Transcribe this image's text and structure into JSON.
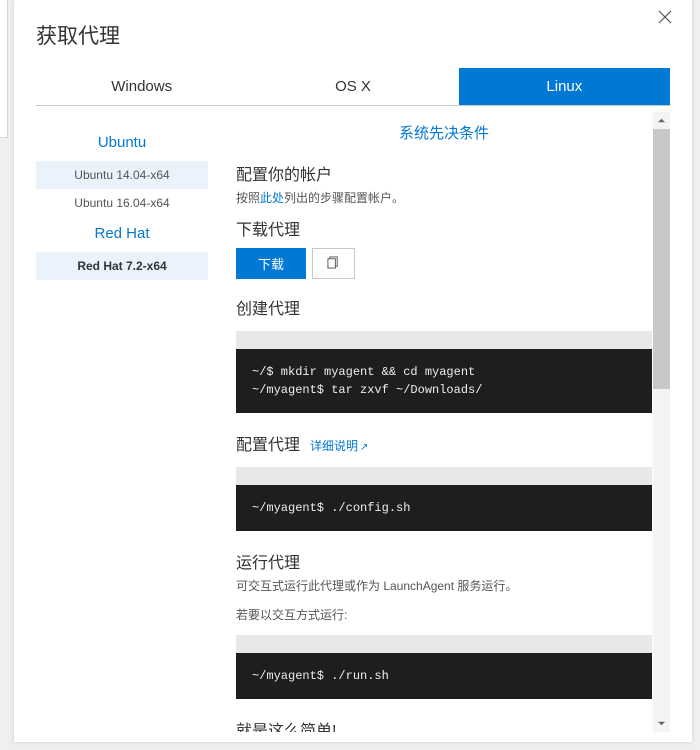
{
  "dialog": {
    "title": "获取代理"
  },
  "tabs": {
    "windows": "Windows",
    "osx": "OS X",
    "linux": "Linux"
  },
  "sidebar": {
    "group_ubuntu": "Ubuntu",
    "item_ubuntu14": "Ubuntu 14.04-x64",
    "item_ubuntu16": "Ubuntu 16.04-x64",
    "group_redhat": "Red Hat",
    "item_redhat72": "Red Hat 7.2-x64"
  },
  "content": {
    "prereq_link": "系统先决条件",
    "configure_account_heading": "配置你的帐户",
    "configure_account_sub_prefix": "按照",
    "configure_account_sub_link": "此处",
    "configure_account_sub_suffix": "列出的步骤配置帐户。",
    "download_heading": "下载代理",
    "download_button": "下载",
    "create_heading": "创建代理",
    "create_code": "~/$ mkdir myagent && cd myagent\n~/myagent$ tar zxvf ~/Downloads/",
    "config_heading": "配置代理",
    "config_detail_link": "详细说明",
    "config_code": "~/myagent$ ./config.sh",
    "run_heading": "运行代理",
    "run_sub1": "可交互式运行此代理或作为 LaunchAgent 服务运行。",
    "run_sub2": "若要以交互方式运行:",
    "run_code": "~/myagent$ ./run.sh",
    "done_heading": "就是这么简单!"
  }
}
